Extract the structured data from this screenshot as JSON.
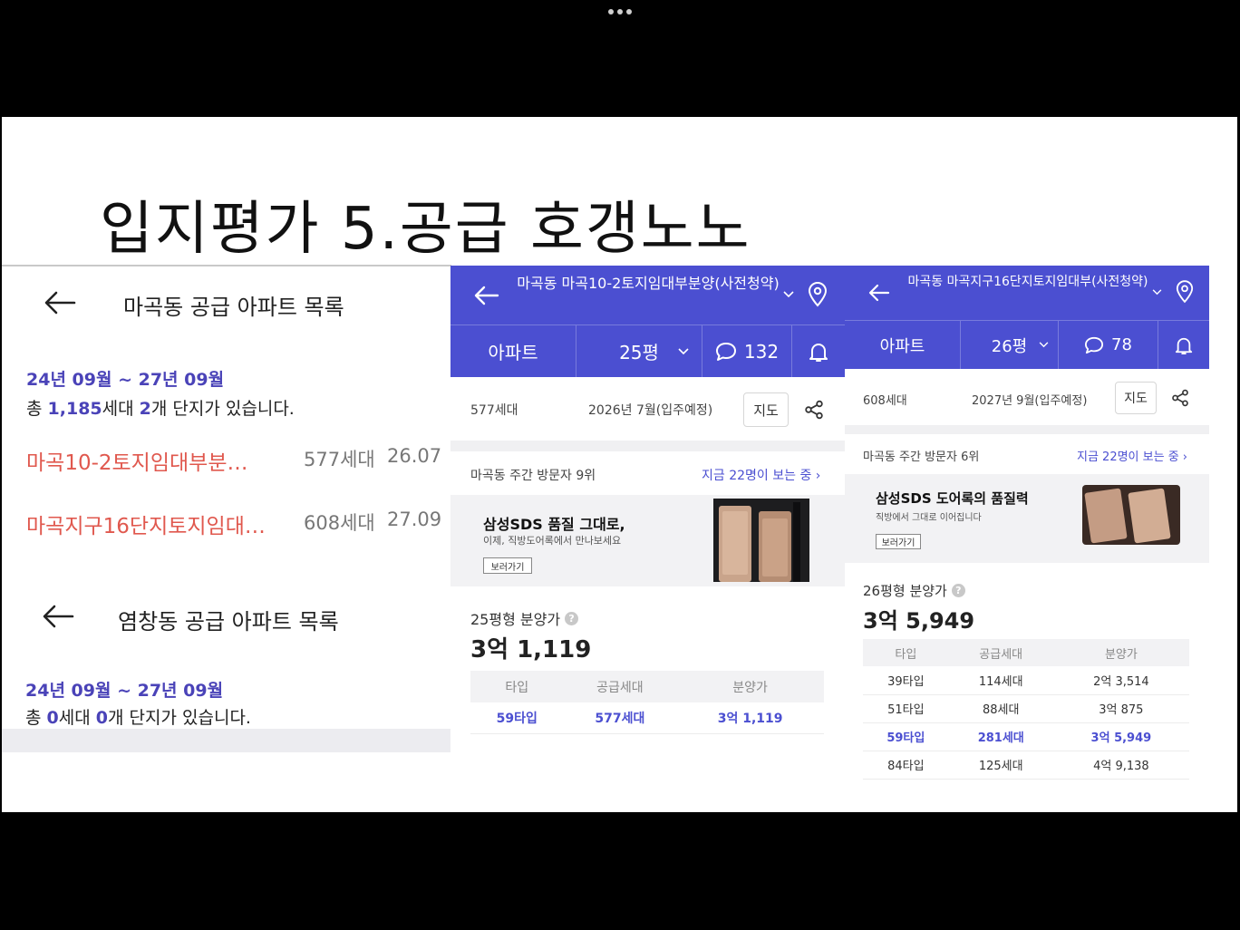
{
  "slide": {
    "title": "입지평가 5.공급 호갱노노"
  },
  "left_panel": {
    "section1": {
      "title": "마곡동 공급 아파트 목록",
      "range": "24년 09월 ~ 27년 09월",
      "summary": {
        "prefix": "총 ",
        "units": "1,185",
        "mid": "세대 ",
        "complexes": "2",
        "suffix": "개 단지가 있습니다."
      },
      "items": [
        {
          "name": "마곡10-2토지임대부분…",
          "units": "577세대",
          "date": "26.07"
        },
        {
          "name": "마곡지구16단지토지임대…",
          "units": "608세대",
          "date": "27.09"
        }
      ]
    },
    "section2": {
      "title": "염창동 공급 아파트 목록",
      "range": "24년 09월 ~ 27년 09월",
      "summary": {
        "prefix": "총 ",
        "units": "0",
        "mid": "세대 ",
        "complexes": "0",
        "suffix": "개 단지가 있습니다."
      }
    }
  },
  "app1": {
    "title": "마곡동 마곡10-2토지임대부분양(사전청약)",
    "tabs": {
      "type": "아파트",
      "size": "25평",
      "comments": "132"
    },
    "info": {
      "units": "577세대",
      "movein": "2026년 7월(입주예정)",
      "map": "지도"
    },
    "visit": {
      "left": "마곡동 주간 방문자 9위",
      "right": "지금 22명이 보는 중 ›"
    },
    "ad": {
      "title": "삼성SDS 품질 그대로,",
      "sub": "이제, 직방도어록에서 만나보세요",
      "button": "보러가기"
    },
    "price_label": "25평형 분양가",
    "price": "3억 1,119",
    "table": {
      "headers": [
        "타입",
        "공급세대",
        "분양가"
      ],
      "rows": [
        {
          "type": "59타입",
          "units": "577세대",
          "price": "3억 1,119",
          "highlight": true
        }
      ]
    }
  },
  "app2": {
    "title": "마곡동 마곡지구16단지토지임대부(사전청약)",
    "tabs": {
      "type": "아파트",
      "size": "26평",
      "comments": "78"
    },
    "info": {
      "units": "608세대",
      "movein": "2027년 9월(입주예정)",
      "map": "지도"
    },
    "visit": {
      "left": "마곡동 주간 방문자 6위",
      "right": "지금 22명이 보는 중 ›"
    },
    "ad": {
      "title": "삼성SDS 도어록의 품질력",
      "sub": "직방에서 그대로 이어집니다",
      "button": "보러가기"
    },
    "price_label": "26평형 분양가",
    "price": "3억 5,949",
    "table": {
      "headers": [
        "타입",
        "공급세대",
        "분양가"
      ],
      "rows": [
        {
          "type": "39타입",
          "units": "114세대",
          "price": "2억 3,514",
          "highlight": false
        },
        {
          "type": "51타입",
          "units": "88세대",
          "price": "3억 875",
          "highlight": false
        },
        {
          "type": "59타입",
          "units": "281세대",
          "price": "3억 5,949",
          "highlight": true
        },
        {
          "type": "84타입",
          "units": "125세대",
          "price": "4억 9,138",
          "highlight": false
        }
      ]
    }
  },
  "colors": {
    "accent": "#4b4fd1",
    "accent_text": "#4a43b8",
    "complex_name": "#e0584e",
    "slide_bg": "#ffffff",
    "frame_bg": "#000000"
  }
}
